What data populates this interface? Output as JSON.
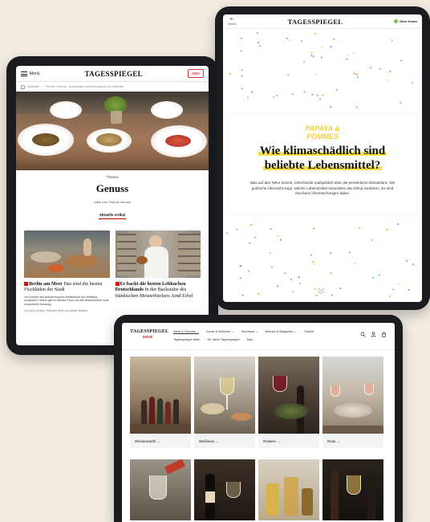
{
  "left_tablet": {
    "header": {
      "menu_label": "Menü",
      "logo": "TAGESSPIEGEL",
      "abo_label": "ABO"
    },
    "breadcrumb": {
      "items": [
        "Startseite",
        "Themen: Genuss - Nachrichten und Informationen im Überblick"
      ]
    },
    "kicker": "Thema",
    "title": "Genuss",
    "subtitle": "Alles zum Thema Genuss",
    "tab_label": "Aktuelle Artikel",
    "articles": [
      {
        "head_bold": "Berlin am Meer",
        "head_rest": " Das sind die besten Fischläden der Stadt",
        "teaser": "Von Karpfen aus Brandenburg bis Wolfsbarsch aus Wildfang: Ausdessen Theken gibt es feinsten Fisch und alle Meeresfrüchte samt kompetenter Beratung.",
        "author": "Von Ulrike Amling, Ferdinand Stahl und Natalie Wellbore"
      },
      {
        "head_bold": "Er backt die besten Lebkuchen Deutschlands",
        "head_rest": " In der Backstube des fränkischen Meisterbäckers Arnd Erbel",
        "teaser": "",
        "author": ""
      }
    ]
  },
  "right_tablet": {
    "header": {
      "back_label": "Zurück",
      "logo": "TAGESSPIEGEL",
      "menu_label": "Mein Konto"
    },
    "brand_line1": "PAPAYA &",
    "brand_line2": "POMMES",
    "headline_line1": "Wie klimaschädlich sind",
    "headline_line2": "beliebte Lebensmittel?",
    "body": "Was auf den Teller kommt, entscheidet maßgeblich über die persönliche Klimabilanz. Die grafische Übersicht zeigt, welche Lebensmittel besonders das Klima zerstören. Es sind durchaus Überraschungen dabei.",
    "colors": {
      "highlight": "#f3e04a",
      "brand": "#f3cf33"
    }
  },
  "shop_tablet": {
    "logo_top": "TAGESSPIEGEL",
    "logo_bottom": "SHOP",
    "nav_row1": [
      "Wein & Genuss ⌄",
      "Kunst & Wohnen ⌄",
      "Schmuck ⌄",
      "Bücher & Magazine ⌄",
      "Tickets"
    ],
    "nav_row2": [
      "Tagesspiegel Wein",
      "90 Jahre Tagesspiegel",
      "Sale"
    ],
    "tiles": [
      {
        "label": "Weinauswahl →"
      },
      {
        "label": "Weißwein →"
      },
      {
        "label": "Rotwein →"
      },
      {
        "label": "Rosé →"
      }
    ]
  }
}
